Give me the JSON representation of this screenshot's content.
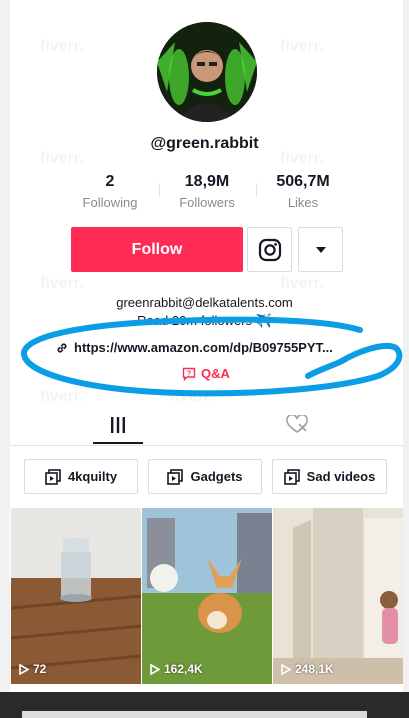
{
  "profile": {
    "username": "@green.rabbit",
    "stats": [
      {
        "value": "2",
        "label": "Following"
      },
      {
        "value": "18,9M",
        "label": "Followers"
      },
      {
        "value": "506,7M",
        "label": "Likes"
      }
    ],
    "follow_label": "Follow",
    "bio_email": "greenrabbit@delkatalents.com",
    "bio_line": "Road 20m followers ✈️",
    "link": "https://www.amazon.com/dp/B09755PYT...",
    "qa_label": "Q&A"
  },
  "playlists": [
    "4kquilty",
    "Gadgets",
    "Sad videos"
  ],
  "videos": [
    {
      "views": "72"
    },
    {
      "views": "162,4K"
    },
    {
      "views": "248,1K"
    }
  ],
  "watermark": "fiverr.",
  "colors": {
    "accent": "#fe2c55",
    "annotation": "#0b9ee6"
  }
}
